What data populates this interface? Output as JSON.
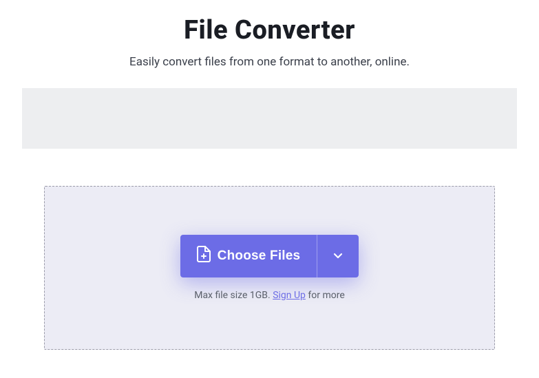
{
  "header": {
    "title": "File Converter",
    "subtitle": "Easily convert files from one format to another, online."
  },
  "dropzone": {
    "button_label": "Choose Files",
    "hint_prefix": "Max file size 1GB. ",
    "hint_link": "Sign Up",
    "hint_suffix": " for more"
  },
  "colors": {
    "accent": "#6c6ce6"
  }
}
